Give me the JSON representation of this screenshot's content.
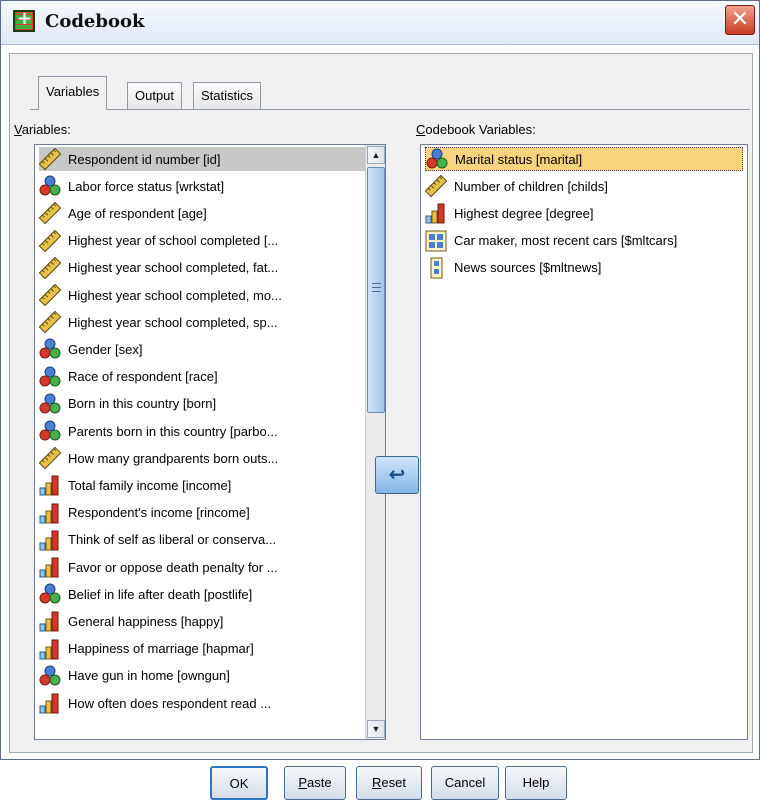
{
  "window": {
    "title": "Codebook",
    "close_symbol": "✕"
  },
  "tabs": [
    {
      "label": "Variables",
      "active": true
    },
    {
      "label": "Output",
      "active": false
    },
    {
      "label": "Statistics",
      "active": false
    }
  ],
  "variables_label": {
    "mnemonic": "V",
    "rest": "ariables:"
  },
  "codebook_label": {
    "mnemonic": "C",
    "rest": "odebook Variables:"
  },
  "source_list": [
    {
      "label": "Respondent id number [id]",
      "icon": "scale-ruler-icon",
      "selected": true
    },
    {
      "label": "Labor force status [wrkstat]",
      "icon": "nominal-balls-icon"
    },
    {
      "label": "Age of respondent [age]",
      "icon": "scale-ruler-icon"
    },
    {
      "label": "Highest year of school completed [...",
      "icon": "scale-ruler-icon"
    },
    {
      "label": "Highest year school completed, fat...",
      "icon": "scale-ruler-icon"
    },
    {
      "label": "Highest year school completed, mo...",
      "icon": "scale-ruler-icon"
    },
    {
      "label": "Highest year school completed, sp...",
      "icon": "scale-ruler-icon"
    },
    {
      "label": "Gender [sex]",
      "icon": "nominal-balls-icon"
    },
    {
      "label": "Race of respondent [race]",
      "icon": "nominal-balls-icon"
    },
    {
      "label": "Born in this country [born]",
      "icon": "nominal-balls-icon"
    },
    {
      "label": "Parents born in this country [parbo...",
      "icon": "nominal-balls-icon"
    },
    {
      "label": "How many grandparents born outs...",
      "icon": "scale-ruler-icon"
    },
    {
      "label": "Total family income [income]",
      "icon": "ordinal-bars-icon"
    },
    {
      "label": "Respondent's income [rincome]",
      "icon": "ordinal-bars-icon"
    },
    {
      "label": "Think of self as liberal or conserva...",
      "icon": "ordinal-bars-icon"
    },
    {
      "label": "Favor or oppose death penalty for ...",
      "icon": "ordinal-bars-icon"
    },
    {
      "label": "Belief in life after death [postlife]",
      "icon": "nominal-balls-icon"
    },
    {
      "label": "General happiness [happy]",
      "icon": "ordinal-bars-icon"
    },
    {
      "label": "Happiness of marriage [hapmar]",
      "icon": "ordinal-bars-icon"
    },
    {
      "label": "Have gun in home [owngun]",
      "icon": "nominal-balls-icon"
    },
    {
      "label": "How often does respondent read ...",
      "icon": "ordinal-bars-icon"
    }
  ],
  "codebook_list": [
    {
      "label": "Marital status [marital]",
      "icon": "nominal-balls-icon",
      "highlighted": true
    },
    {
      "label": "Number of children [childs]",
      "icon": "scale-ruler-icon"
    },
    {
      "label": "Highest degree [degree]",
      "icon": "ordinal-bars-icon"
    },
    {
      "label": "Car maker, most recent cars [$mltcars]",
      "icon": "multiple-dichotomy-set-icon"
    },
    {
      "label": "News sources [$mltnews]",
      "icon": "multiple-category-set-icon"
    }
  ],
  "move_button": {
    "symbol": "↩",
    "icon": "move-arrow-icon"
  },
  "buttons": [
    {
      "label": "OK"
    },
    {
      "label": "Paste",
      "mnemonic": "P",
      "rest": "aste"
    },
    {
      "label": "Reset",
      "mnemonic": "R",
      "rest": "eset"
    },
    {
      "label": "Cancel"
    },
    {
      "label": "Help"
    }
  ],
  "colors": {
    "selected_row": "#c8c8c8",
    "highlight_row": "#f7d37b",
    "scroll_thumb": "#a4c5ea"
  }
}
